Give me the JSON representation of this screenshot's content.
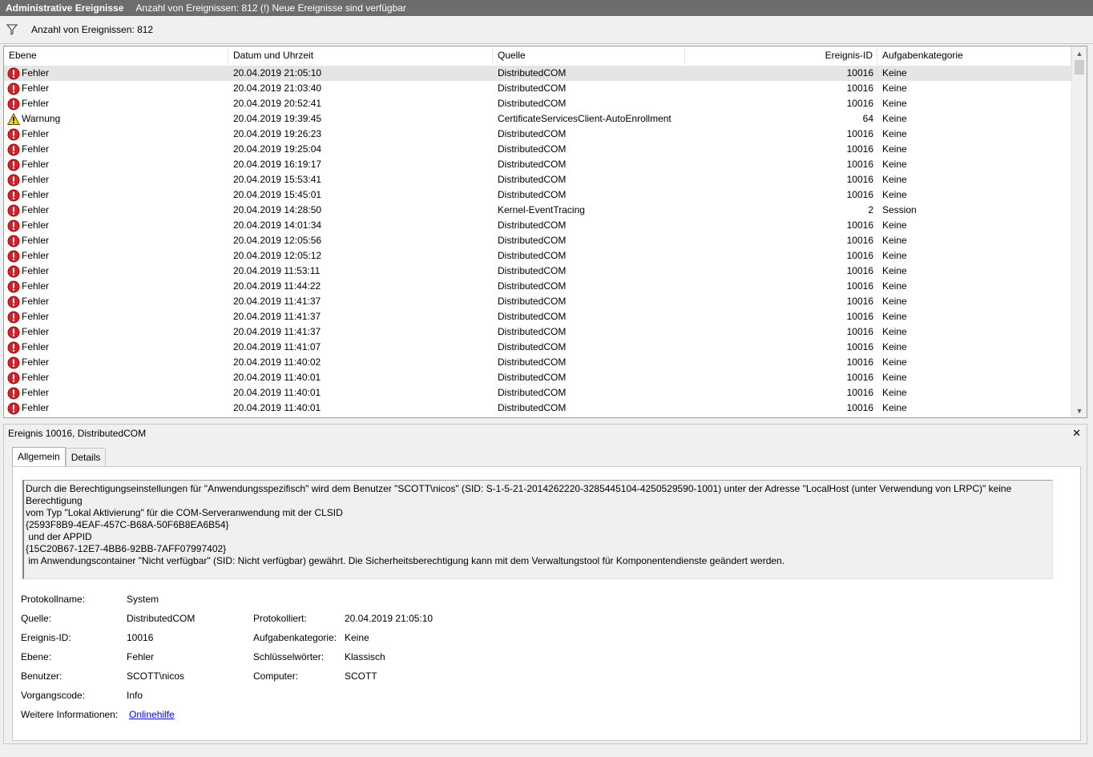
{
  "titlebar": {
    "title": "Administrative Ereignisse",
    "status": "Anzahl von Ereignissen: 812 (!) Neue Ereignisse sind verfügbar"
  },
  "filterbar": {
    "icon": "filter-icon",
    "text": "Anzahl von Ereignissen: 812"
  },
  "list": {
    "columns": [
      "Ebene",
      "Datum und Uhrzeit",
      "Quelle",
      "Ereignis-ID",
      "Aufgabenkategorie"
    ],
    "rows": [
      {
        "level": "Fehler",
        "icon": "error-icon",
        "date": "20.04.2019 21:05:10",
        "source": "DistributedCOM",
        "id": "10016",
        "category": "Keine"
      },
      {
        "level": "Fehler",
        "icon": "error-icon",
        "date": "20.04.2019 21:03:40",
        "source": "DistributedCOM",
        "id": "10016",
        "category": "Keine"
      },
      {
        "level": "Fehler",
        "icon": "error-icon",
        "date": "20.04.2019 20:52:41",
        "source": "DistributedCOM",
        "id": "10016",
        "category": "Keine"
      },
      {
        "level": "Warnung",
        "icon": "warning-icon",
        "date": "20.04.2019 19:39:45",
        "source": "CertificateServicesClient-AutoEnrollment",
        "id": "64",
        "category": "Keine"
      },
      {
        "level": "Fehler",
        "icon": "error-icon",
        "date": "20.04.2019 19:26:23",
        "source": "DistributedCOM",
        "id": "10016",
        "category": "Keine"
      },
      {
        "level": "Fehler",
        "icon": "error-icon",
        "date": "20.04.2019 19:25:04",
        "source": "DistributedCOM",
        "id": "10016",
        "category": "Keine"
      },
      {
        "level": "Fehler",
        "icon": "error-icon",
        "date": "20.04.2019 16:19:17",
        "source": "DistributedCOM",
        "id": "10016",
        "category": "Keine"
      },
      {
        "level": "Fehler",
        "icon": "error-icon",
        "date": "20.04.2019 15:53:41",
        "source": "DistributedCOM",
        "id": "10016",
        "category": "Keine"
      },
      {
        "level": "Fehler",
        "icon": "error-icon",
        "date": "20.04.2019 15:45:01",
        "source": "DistributedCOM",
        "id": "10016",
        "category": "Keine"
      },
      {
        "level": "Fehler",
        "icon": "error-icon",
        "date": "20.04.2019 14:28:50",
        "source": "Kernel-EventTracing",
        "id": "2",
        "category": "Session"
      },
      {
        "level": "Fehler",
        "icon": "error-icon",
        "date": "20.04.2019 14:01:34",
        "source": "DistributedCOM",
        "id": "10016",
        "category": "Keine"
      },
      {
        "level": "Fehler",
        "icon": "error-icon",
        "date": "20.04.2019 12:05:56",
        "source": "DistributedCOM",
        "id": "10016",
        "category": "Keine"
      },
      {
        "level": "Fehler",
        "icon": "error-icon",
        "date": "20.04.2019 12:05:12",
        "source": "DistributedCOM",
        "id": "10016",
        "category": "Keine"
      },
      {
        "level": "Fehler",
        "icon": "error-icon",
        "date": "20.04.2019 11:53:11",
        "source": "DistributedCOM",
        "id": "10016",
        "category": "Keine"
      },
      {
        "level": "Fehler",
        "icon": "error-icon",
        "date": "20.04.2019 11:44:22",
        "source": "DistributedCOM",
        "id": "10016",
        "category": "Keine"
      },
      {
        "level": "Fehler",
        "icon": "error-icon",
        "date": "20.04.2019 11:41:37",
        "source": "DistributedCOM",
        "id": "10016",
        "category": "Keine"
      },
      {
        "level": "Fehler",
        "icon": "error-icon",
        "date": "20.04.2019 11:41:37",
        "source": "DistributedCOM",
        "id": "10016",
        "category": "Keine"
      },
      {
        "level": "Fehler",
        "icon": "error-icon",
        "date": "20.04.2019 11:41:37",
        "source": "DistributedCOM",
        "id": "10016",
        "category": "Keine"
      },
      {
        "level": "Fehler",
        "icon": "error-icon",
        "date": "20.04.2019 11:41:07",
        "source": "DistributedCOM",
        "id": "10016",
        "category": "Keine"
      },
      {
        "level": "Fehler",
        "icon": "error-icon",
        "date": "20.04.2019 11:40:02",
        "source": "DistributedCOM",
        "id": "10016",
        "category": "Keine"
      },
      {
        "level": "Fehler",
        "icon": "error-icon",
        "date": "20.04.2019 11:40:01",
        "source": "DistributedCOM",
        "id": "10016",
        "category": "Keine"
      },
      {
        "level": "Fehler",
        "icon": "error-icon",
        "date": "20.04.2019 11:40:01",
        "source": "DistributedCOM",
        "id": "10016",
        "category": "Keine"
      },
      {
        "level": "Fehler",
        "icon": "error-icon",
        "date": "20.04.2019 11:40:01",
        "source": "DistributedCOM",
        "id": "10016",
        "category": "Keine"
      }
    ]
  },
  "detail": {
    "header": "Ereignis 10016, DistributedCOM",
    "close": "✕",
    "tabs": [
      "Allgemein",
      "Details"
    ],
    "message": "Durch die Berechtigungseinstellungen für \"Anwendungsspezifisch\" wird dem Benutzer \"SCOTT\\nicos\" (SID: S-1-5-21-2014262220-3285445104-4250529590-1001) unter der Adresse \"LocalHost (unter Verwendung von LRPC)\" keine Berechtigung\nvom Typ \"Lokal Aktivierung\" für die COM-Serveranwendung mit der CLSID\n{2593F8B9-4EAF-457C-B68A-50F6B8EA6B54}\n und der APPID\n{15C20B67-12E7-4BB6-92BB-7AFF07997402}\n im Anwendungscontainer \"Nicht verfügbar\" (SID: Nicht verfügbar) gewährt. Die Sicherheitsberechtigung kann mit dem Verwaltungstool für Komponentendienste geändert werden.",
    "props": {
      "protokollname": {
        "label": "Protokollname:",
        "value": "System"
      },
      "quelle": {
        "label": "Quelle:",
        "value": "DistributedCOM"
      },
      "ereignis_id": {
        "label": "Ereignis-ID:",
        "value": "10016"
      },
      "ebene": {
        "label": "Ebene:",
        "value": "Fehler"
      },
      "benutzer": {
        "label": "Benutzer:",
        "value": "SCOTT\\nicos"
      },
      "vorgangscode": {
        "label": "Vorgangscode:",
        "value": "Info"
      },
      "weitere": {
        "label": "Weitere Informationen:",
        "value": "Onlinehilfe"
      },
      "protokolliert": {
        "label": "Protokolliert:",
        "value": "20.04.2019 21:05:10"
      },
      "aufgabenkategorie": {
        "label": "Aufgabenkategorie:",
        "value": "Keine"
      },
      "schluesselwoerter": {
        "label": "Schlüsselwörter:",
        "value": "Klassisch"
      },
      "computer": {
        "label": "Computer:",
        "value": "SCOTT"
      }
    }
  }
}
